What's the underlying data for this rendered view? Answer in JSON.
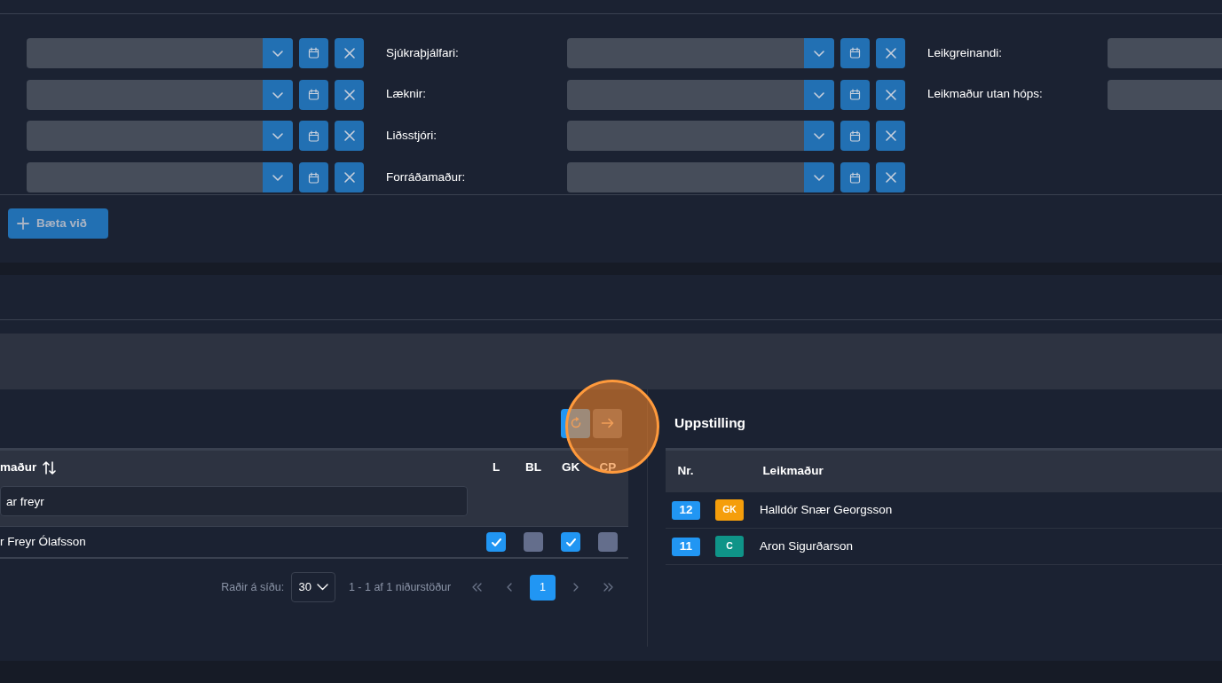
{
  "staff_form": {
    "rows": [
      {
        "label": "Sjúkraþjálfari:"
      },
      {
        "label": "Læknir:"
      },
      {
        "label": "Liðsstjóri:"
      },
      {
        "label": "Forráðamaður:"
      }
    ],
    "extra_fields": [
      {
        "label": "Leikgreinandi:"
      },
      {
        "label": "Leikmaður utan hóps:"
      }
    ],
    "add_button": "Bæta við"
  },
  "players_table": {
    "actions": [
      {
        "kind": "refresh",
        "disabled": false
      },
      {
        "kind": "arrow",
        "disabled": true
      }
    ],
    "columns": [
      {
        "label": "maður",
        "kind": "sort"
      },
      {
        "label": "L"
      },
      {
        "label": "BL"
      },
      {
        "label": "GK"
      },
      {
        "label": "CP"
      }
    ],
    "filter_value": "ar freyr",
    "rows": [
      {
        "name": "r Freyr Ólafsson",
        "checks": [
          {
            "checked": true
          },
          {
            "checked": false
          },
          {
            "checked": true
          },
          {
            "checked": false
          }
        ]
      }
    ],
    "pagination": {
      "rows_per_page_label": "Raðir á síðu:",
      "rows_per_page": "30",
      "summary": "1 - 1 af 1 niðurstöður",
      "pages": [
        {
          "label": "1",
          "selected": true
        }
      ]
    }
  },
  "lineup": {
    "title": "Uppstilling",
    "columns": [
      "Nr.",
      "Leikmaður"
    ],
    "rows": [
      {
        "number": "12",
        "position": "GK",
        "color": "#f59e0b",
        "name": "Halldór Snær Georgsson"
      },
      {
        "number": "11",
        "position": "C",
        "color": "#0f9488",
        "name": "Aron Sigurðarson"
      }
    ]
  },
  "click_highlight": {
    "kind": "circle"
  }
}
